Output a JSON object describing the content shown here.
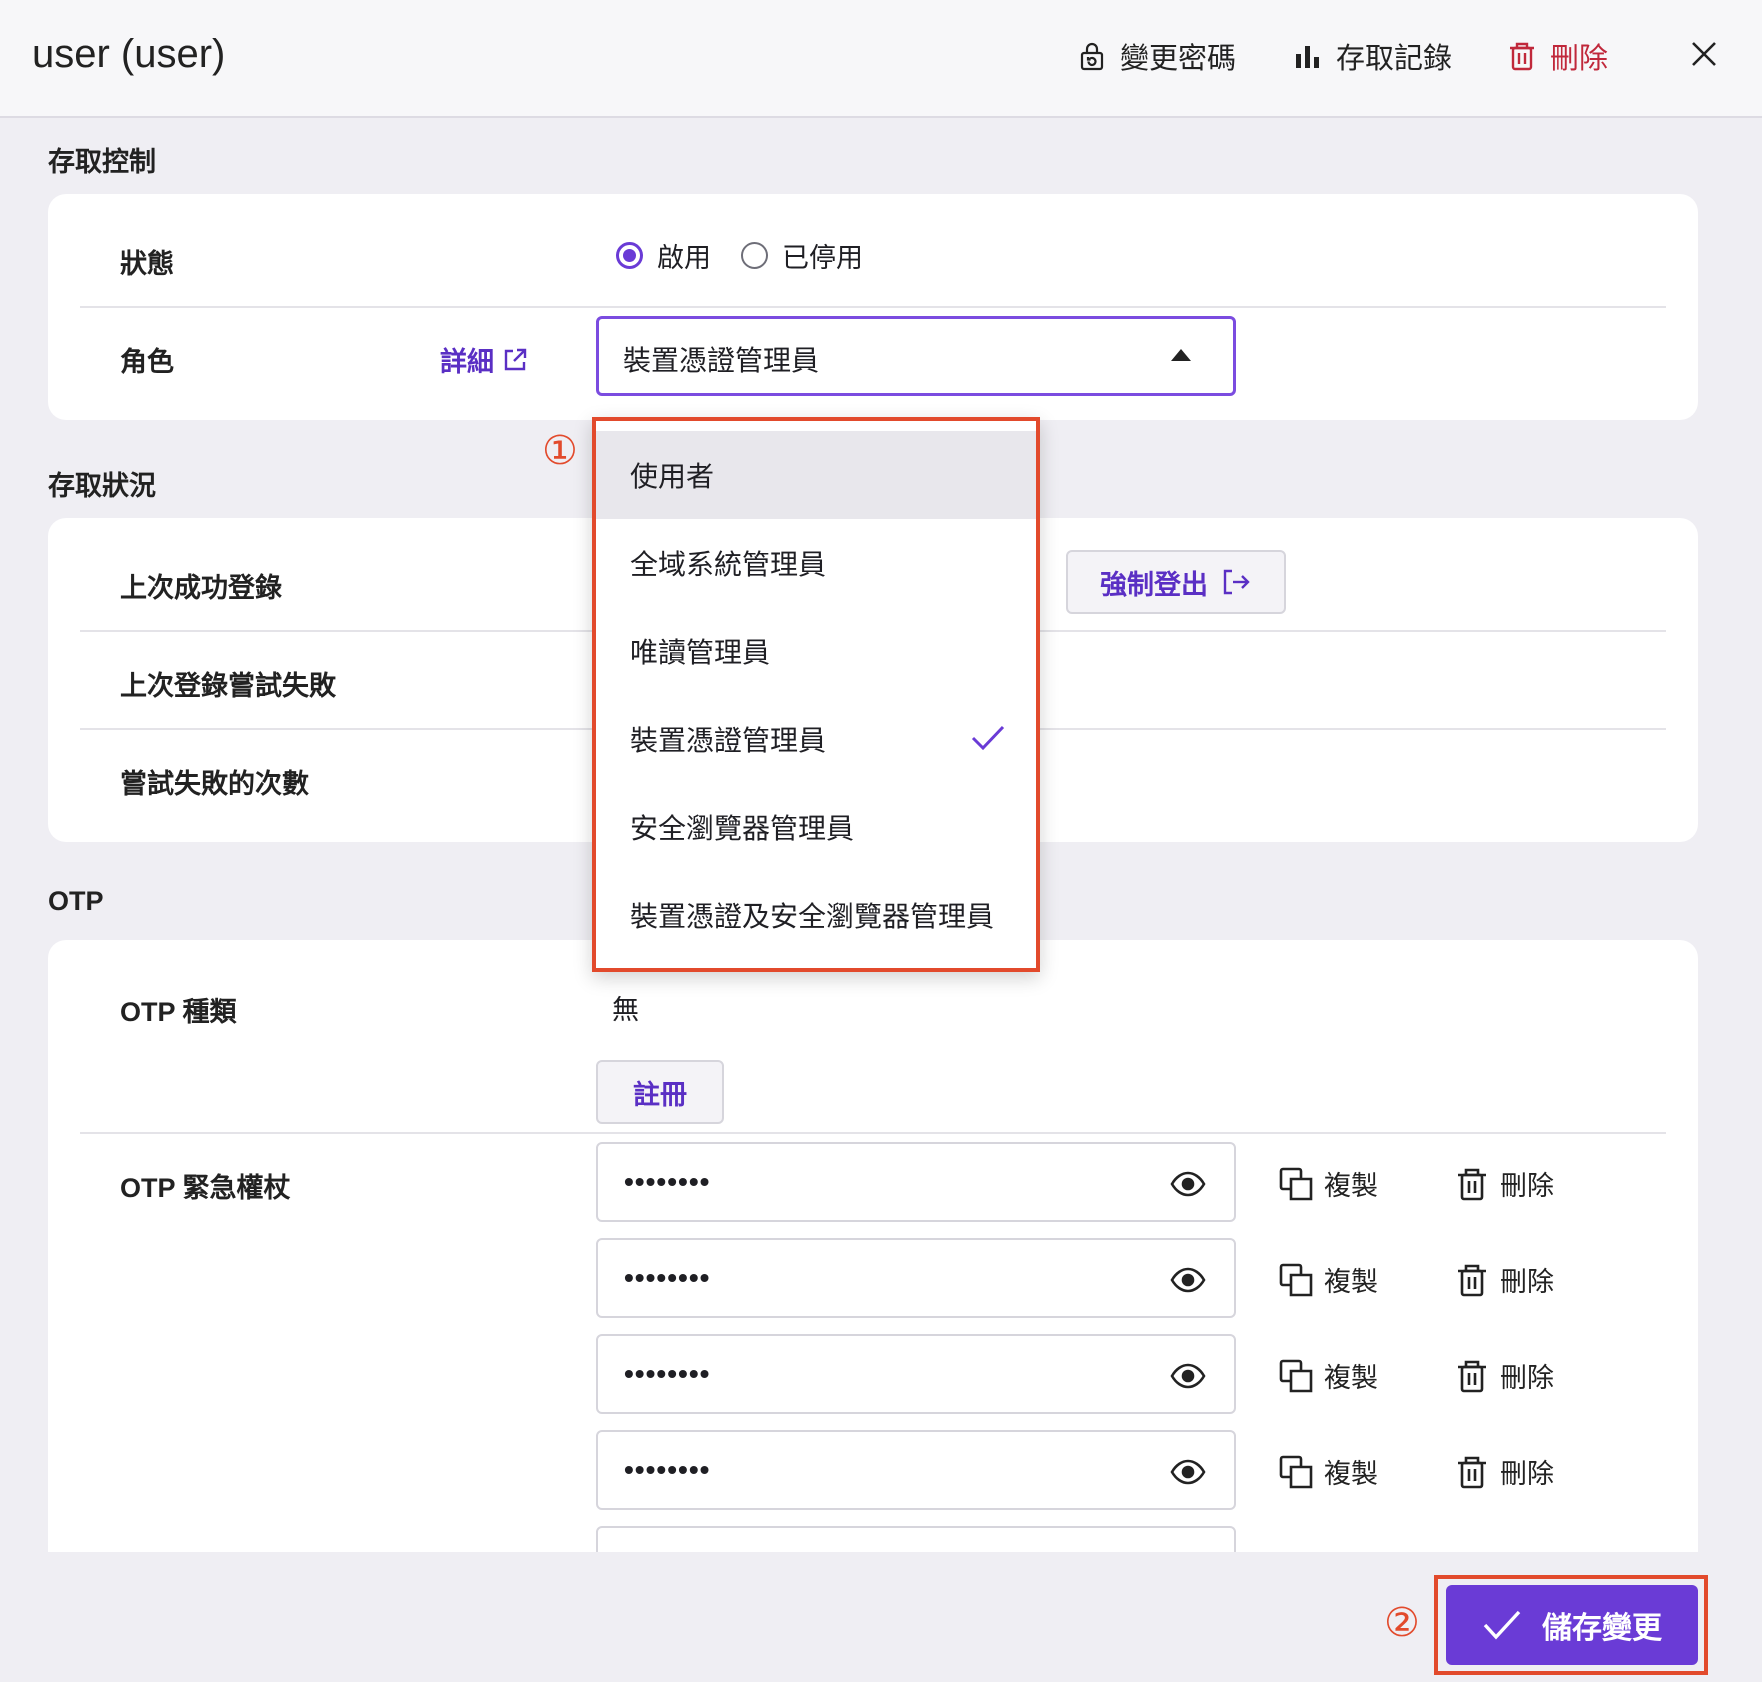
{
  "header": {
    "title": "user (user)",
    "change_password": "變更密碼",
    "access_log": "存取記錄",
    "delete": "刪除"
  },
  "access_control": {
    "section_title": "存取控制",
    "status_label": "狀態",
    "status_options": [
      "啟用",
      "已停用"
    ],
    "status_selected": "啟用",
    "role_label": "角色",
    "details_link": "詳細",
    "role_selected": "裝置憑證管理員"
  },
  "dropdown": {
    "items": [
      "使用者",
      "全域系統管理員",
      "唯讀管理員",
      "裝置憑證管理員",
      "安全瀏覽器管理員",
      "裝置憑證及安全瀏覽器管理員"
    ],
    "hovered": "使用者",
    "checked": "裝置憑證管理員"
  },
  "access_status": {
    "section_title": "存取狀況",
    "last_success_login": "上次成功登錄",
    "last_failed_login": "上次登錄嘗試失敗",
    "failed_attempts": "嘗試失敗的次數",
    "force_logout": "強制登出"
  },
  "otp": {
    "section_title": "OTP",
    "type_label": "OTP 種類",
    "type_value": "無",
    "register_button": "註冊",
    "emergency_label": "OTP 緊急權杖",
    "codes": [
      "••••••••",
      "••••••••",
      "••••••••",
      "••••••••"
    ],
    "copy_label": "複製",
    "delete_label": "刪除"
  },
  "annotations": {
    "marker_1": "①",
    "marker_2": "②"
  },
  "footer": {
    "save_button": "儲存變更"
  },
  "colors": {
    "accent": "#6a3bd6",
    "danger": "#c0283b",
    "highlight_box": "#e24a2c"
  }
}
